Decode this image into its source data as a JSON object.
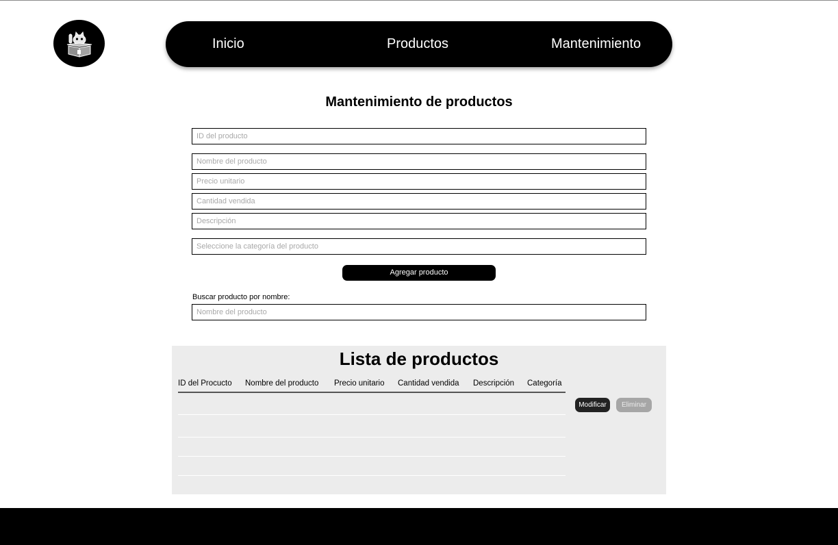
{
  "nav": {
    "items": [
      {
        "label": "Inicio"
      },
      {
        "label": "Productos"
      },
      {
        "label": "Mantenimiento"
      }
    ],
    "logo_icon": "cat-in-box-icon"
  },
  "page": {
    "title": "Mantenimiento de productos"
  },
  "form": {
    "id_placeholder": "ID del producto",
    "nombre_placeholder": "Nombre del producto",
    "precio_placeholder": "Precio unitario",
    "cantidad_placeholder": "Cantidad vendida",
    "descripcion_placeholder": "Descripción",
    "categoria_placeholder": "Seleccione la categoría del producto",
    "add_label": "Agregar producto"
  },
  "search": {
    "label": "Buscar producto por nombre:",
    "placeholder": "Nombre del producto"
  },
  "list": {
    "title": "Lista de productos",
    "columns": [
      "ID del Procucto",
      "Nombre del producto",
      "Precio unitario",
      "Cantidad vendida",
      "Descripción",
      "Categoría"
    ],
    "modify_label": "Modificar",
    "delete_label": "Eliminar"
  },
  "colors": {
    "primary": "#000000",
    "panel": "#ececec",
    "disabled_button": "#a6a6a6"
  }
}
